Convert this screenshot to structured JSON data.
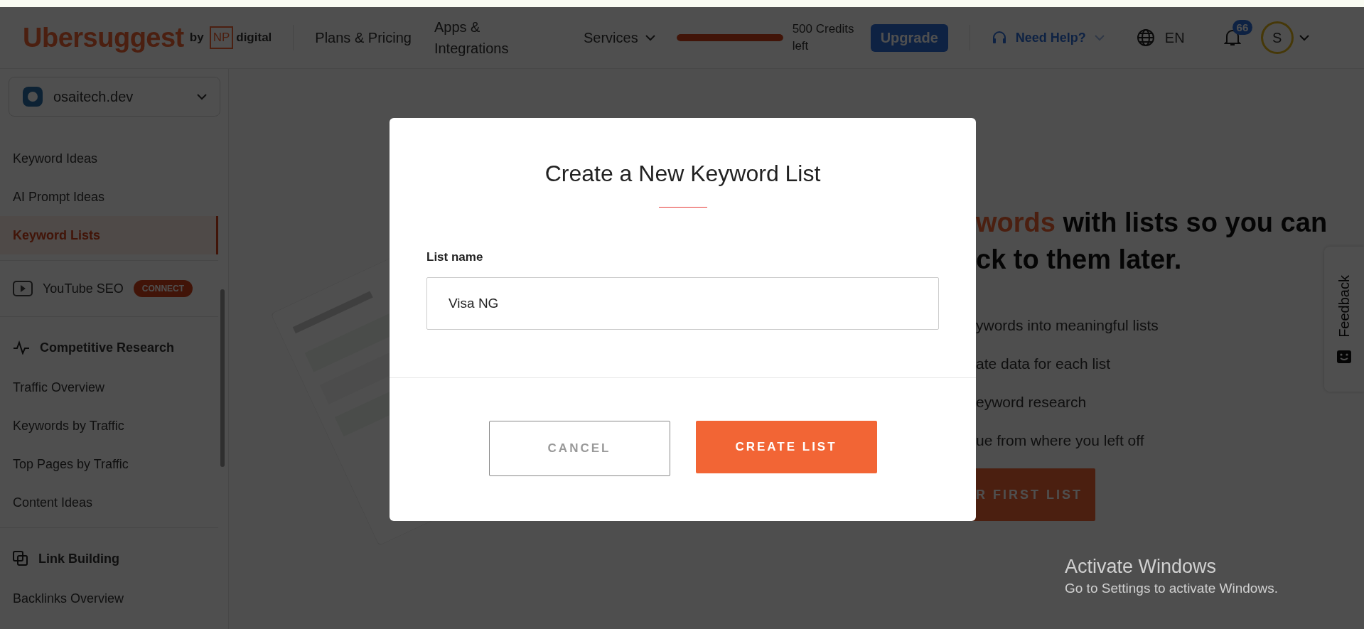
{
  "header": {
    "logo": {
      "brand": "Ubersuggest",
      "by": "by",
      "np": "NP",
      "digital": "digital"
    },
    "nav": [
      {
        "label": "Plans & Pricing"
      },
      {
        "label": "Apps & Integrations"
      }
    ],
    "services": {
      "label": "Services"
    },
    "credits": {
      "level": 1,
      "text": "500 Credits left"
    },
    "upgrade": "Upgrade",
    "help": "Need Help?",
    "language": "EN",
    "notifications": "66",
    "avatar": "S"
  },
  "sidebar": {
    "project": "osaitech.dev",
    "items": [
      {
        "kind": "link",
        "label": "Keyword Ideas",
        "selected": false
      },
      {
        "kind": "link",
        "label": "AI Prompt Ideas",
        "selected": false
      },
      {
        "kind": "link",
        "label": "Keyword Lists",
        "selected": true
      },
      {
        "kind": "divider"
      },
      {
        "kind": "app",
        "label": "YouTube SEO",
        "badge": "CONNECT"
      },
      {
        "kind": "divider"
      },
      {
        "kind": "section",
        "label": "Competitive Research"
      },
      {
        "kind": "link",
        "label": "Traffic Overview",
        "selected": false
      },
      {
        "kind": "link",
        "label": "Keywords by Traffic",
        "selected": false
      },
      {
        "kind": "link",
        "label": "Top Pages by Traffic",
        "selected": false
      },
      {
        "kind": "link",
        "label": "Content Ideas",
        "selected": false
      },
      {
        "kind": "divider"
      },
      {
        "kind": "section",
        "label": "Link Building"
      },
      {
        "kind": "link",
        "label": "Backlinks Overview",
        "selected": false
      }
    ]
  },
  "hero": {
    "heading": {
      "highlight": "words",
      "rest": "with lists so you can",
      "line_2": "ck to them later."
    },
    "bullets": [
      "ywords into meaningful lists",
      "ate data for each list",
      "eyword research",
      "ue from where you left off"
    ],
    "button": "R FIRST LIST"
  },
  "feedback": "Feedback",
  "modal": {
    "title": "Create a New Keyword List",
    "field_label": "List name",
    "field_value": "Visa NG",
    "cancel": "CANCEL",
    "create": "CREATE LIST"
  },
  "os_notice": {
    "title": "Activate Windows",
    "text": "Go to Settings to activate Windows."
  }
}
